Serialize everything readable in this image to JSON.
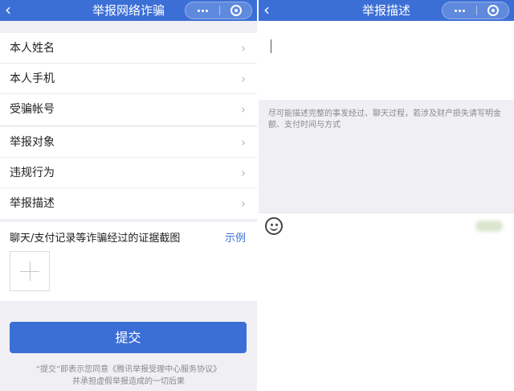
{
  "left": {
    "nav_title": "举报网络诈骗",
    "group1": [
      "本人姓名",
      "本人手机",
      "受骗帐号"
    ],
    "group2": [
      "举报对象",
      "违规行为",
      "举报描述"
    ],
    "evidence_label": "聊天/支付记录等诈骗经过的证据截图",
    "evidence_example": "示例",
    "submit_label": "提交",
    "agreement_line1": "“提交”即表示您同意《腾讯举报受理中心服务协议》",
    "agreement_line2": "并承担虚假举报造成的一切后果"
  },
  "right": {
    "nav_title": "举报描述",
    "placeholder": "尽可能描述完整的事发经过、聊天过程，若涉及财产损失请写明金额、支付时间与方式"
  },
  "icons": {
    "back": "chevron-left-icon",
    "more": "more-dots-icon",
    "close": "target-close-icon",
    "chevron": "chevron-right-icon",
    "emoji": "emoji-face-icon"
  },
  "colors": {
    "brand": "#3c6fd6",
    "background": "#f0f0f4",
    "hint_text": "#8a8a8a"
  }
}
